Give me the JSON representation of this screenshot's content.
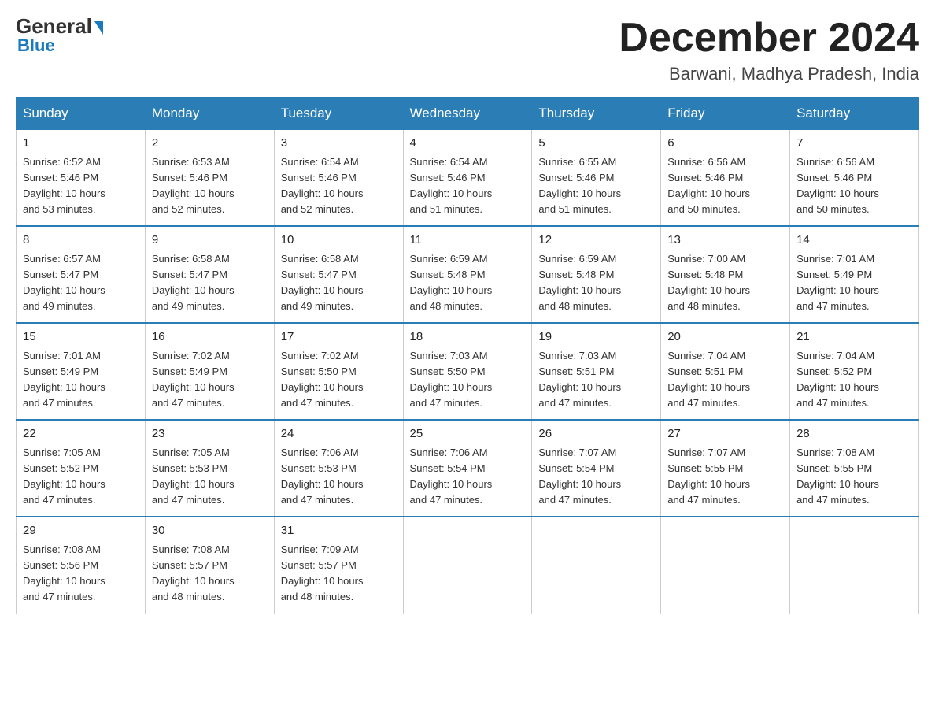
{
  "logo": {
    "general": "General",
    "blue": "Blue",
    "arrow": "▶"
  },
  "title": "December 2024",
  "subtitle": "Barwani, Madhya Pradesh, India",
  "days_of_week": [
    "Sunday",
    "Monday",
    "Tuesday",
    "Wednesday",
    "Thursday",
    "Friday",
    "Saturday"
  ],
  "weeks": [
    [
      {
        "day": "1",
        "sunrise": "6:52 AM",
        "sunset": "5:46 PM",
        "daylight": "10 hours and 53 minutes."
      },
      {
        "day": "2",
        "sunrise": "6:53 AM",
        "sunset": "5:46 PM",
        "daylight": "10 hours and 52 minutes."
      },
      {
        "day": "3",
        "sunrise": "6:54 AM",
        "sunset": "5:46 PM",
        "daylight": "10 hours and 52 minutes."
      },
      {
        "day": "4",
        "sunrise": "6:54 AM",
        "sunset": "5:46 PM",
        "daylight": "10 hours and 51 minutes."
      },
      {
        "day": "5",
        "sunrise": "6:55 AM",
        "sunset": "5:46 PM",
        "daylight": "10 hours and 51 minutes."
      },
      {
        "day": "6",
        "sunrise": "6:56 AM",
        "sunset": "5:46 PM",
        "daylight": "10 hours and 50 minutes."
      },
      {
        "day": "7",
        "sunrise": "6:56 AM",
        "sunset": "5:46 PM",
        "daylight": "10 hours and 50 minutes."
      }
    ],
    [
      {
        "day": "8",
        "sunrise": "6:57 AM",
        "sunset": "5:47 PM",
        "daylight": "10 hours and 49 minutes."
      },
      {
        "day": "9",
        "sunrise": "6:58 AM",
        "sunset": "5:47 PM",
        "daylight": "10 hours and 49 minutes."
      },
      {
        "day": "10",
        "sunrise": "6:58 AM",
        "sunset": "5:47 PM",
        "daylight": "10 hours and 49 minutes."
      },
      {
        "day": "11",
        "sunrise": "6:59 AM",
        "sunset": "5:48 PM",
        "daylight": "10 hours and 48 minutes."
      },
      {
        "day": "12",
        "sunrise": "6:59 AM",
        "sunset": "5:48 PM",
        "daylight": "10 hours and 48 minutes."
      },
      {
        "day": "13",
        "sunrise": "7:00 AM",
        "sunset": "5:48 PM",
        "daylight": "10 hours and 48 minutes."
      },
      {
        "day": "14",
        "sunrise": "7:01 AM",
        "sunset": "5:49 PM",
        "daylight": "10 hours and 47 minutes."
      }
    ],
    [
      {
        "day": "15",
        "sunrise": "7:01 AM",
        "sunset": "5:49 PM",
        "daylight": "10 hours and 47 minutes."
      },
      {
        "day": "16",
        "sunrise": "7:02 AM",
        "sunset": "5:49 PM",
        "daylight": "10 hours and 47 minutes."
      },
      {
        "day": "17",
        "sunrise": "7:02 AM",
        "sunset": "5:50 PM",
        "daylight": "10 hours and 47 minutes."
      },
      {
        "day": "18",
        "sunrise": "7:03 AM",
        "sunset": "5:50 PM",
        "daylight": "10 hours and 47 minutes."
      },
      {
        "day": "19",
        "sunrise": "7:03 AM",
        "sunset": "5:51 PM",
        "daylight": "10 hours and 47 minutes."
      },
      {
        "day": "20",
        "sunrise": "7:04 AM",
        "sunset": "5:51 PM",
        "daylight": "10 hours and 47 minutes."
      },
      {
        "day": "21",
        "sunrise": "7:04 AM",
        "sunset": "5:52 PM",
        "daylight": "10 hours and 47 minutes."
      }
    ],
    [
      {
        "day": "22",
        "sunrise": "7:05 AM",
        "sunset": "5:52 PM",
        "daylight": "10 hours and 47 minutes."
      },
      {
        "day": "23",
        "sunrise": "7:05 AM",
        "sunset": "5:53 PM",
        "daylight": "10 hours and 47 minutes."
      },
      {
        "day": "24",
        "sunrise": "7:06 AM",
        "sunset": "5:53 PM",
        "daylight": "10 hours and 47 minutes."
      },
      {
        "day": "25",
        "sunrise": "7:06 AM",
        "sunset": "5:54 PM",
        "daylight": "10 hours and 47 minutes."
      },
      {
        "day": "26",
        "sunrise": "7:07 AM",
        "sunset": "5:54 PM",
        "daylight": "10 hours and 47 minutes."
      },
      {
        "day": "27",
        "sunrise": "7:07 AM",
        "sunset": "5:55 PM",
        "daylight": "10 hours and 47 minutes."
      },
      {
        "day": "28",
        "sunrise": "7:08 AM",
        "sunset": "5:55 PM",
        "daylight": "10 hours and 47 minutes."
      }
    ],
    [
      {
        "day": "29",
        "sunrise": "7:08 AM",
        "sunset": "5:56 PM",
        "daylight": "10 hours and 47 minutes."
      },
      {
        "day": "30",
        "sunrise": "7:08 AM",
        "sunset": "5:57 PM",
        "daylight": "10 hours and 48 minutes."
      },
      {
        "day": "31",
        "sunrise": "7:09 AM",
        "sunset": "5:57 PM",
        "daylight": "10 hours and 48 minutes."
      },
      null,
      null,
      null,
      null
    ]
  ],
  "labels": {
    "sunrise": "Sunrise: ",
    "sunset": "Sunset: ",
    "daylight": "Daylight: "
  }
}
